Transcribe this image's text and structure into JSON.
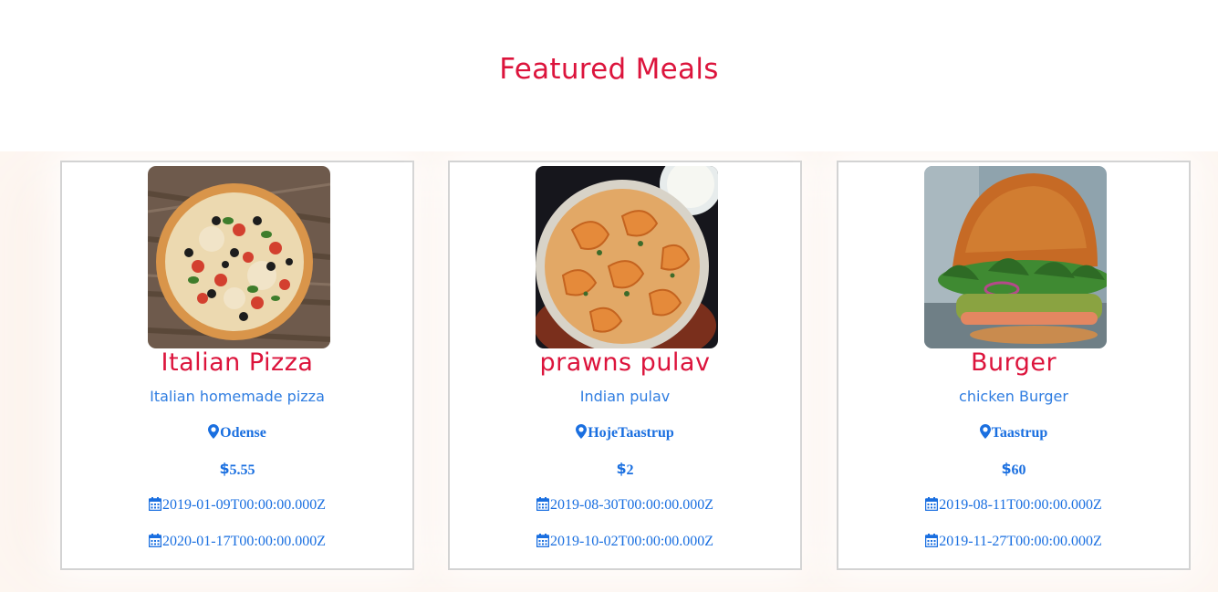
{
  "section": {
    "title": "Featured Meals"
  },
  "colors": {
    "title": "#dc143c",
    "info": "#1a6fe0",
    "description": "#2f7de1",
    "band_background": "#fcf1ea"
  },
  "meals": [
    {
      "name": "Italian Pizza",
      "description": "Italian homemade pizza",
      "location": "Odense",
      "price": "5.55",
      "created_date": "2019-01-09T00:00:00.000Z",
      "when_date": "2020-01-17T00:00:00.000Z",
      "image": "pizza-photo",
      "icons": [
        "map-marker-icon",
        "dollar-icon",
        "calendar-icon"
      ]
    },
    {
      "name": "prawns pulav",
      "description": "Indian pulav",
      "location": "HojeTaastrup",
      "price": "2",
      "created_date": "2019-08-30T00:00:00.000Z",
      "when_date": "2019-10-02T00:00:00.000Z",
      "image": "prawns-pulav-photo",
      "icons": [
        "map-marker-icon",
        "dollar-icon",
        "calendar-icon"
      ]
    },
    {
      "name": "Burger",
      "description": "chicken Burger",
      "location": "Taastrup",
      "price": "60",
      "created_date": "2019-08-11T00:00:00.000Z",
      "when_date": "2019-11-27T00:00:00.000Z",
      "image": "burger-photo",
      "icons": [
        "map-marker-icon",
        "dollar-icon",
        "calendar-icon"
      ]
    }
  ]
}
